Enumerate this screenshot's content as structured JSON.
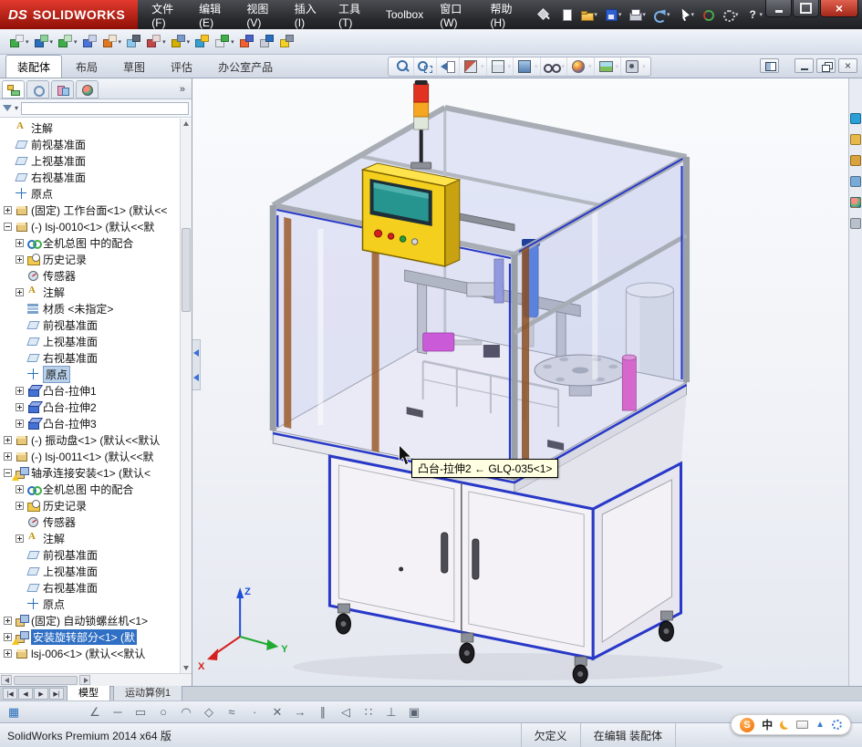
{
  "titlebar": {
    "brand": {
      "prefix": "DS",
      "name": "SOLIDWORKS"
    },
    "menus": [
      "文件(F)",
      "编辑(E)",
      "视图(V)",
      "插入(I)",
      "工具(T)",
      "Toolbox",
      "窗口(W)",
      "帮助(H)"
    ],
    "quick_icons": [
      {
        "name": "new-document"
      },
      {
        "name": "open",
        "dd": true
      },
      {
        "name": "save",
        "dd": true
      },
      {
        "name": "print",
        "dd": true
      },
      {
        "name": "undo",
        "dd": true
      },
      {
        "name": "select",
        "dd": true
      },
      {
        "name": "rebuild"
      },
      {
        "name": "options",
        "dd": true
      },
      {
        "name": "help",
        "dd": true
      }
    ],
    "window_buttons": [
      "minimize",
      "maximize",
      "close"
    ]
  },
  "assembly_toolbar": [
    {
      "name": "insert-components",
      "c1": "#3fae49",
      "c2": "#e8eef4",
      "dd": true
    },
    {
      "name": "mate",
      "c1": "#2a6fbd",
      "c2": "#8fd19e",
      "dd": true
    },
    {
      "name": "linear-component-pattern",
      "c1": "#3fae49",
      "c2": "#bfe6c4",
      "dd": true
    },
    {
      "name": "smart-fasteners",
      "c1": "#4a74d8",
      "c2": "#c9d2e8"
    },
    {
      "name": "move-component",
      "c1": "#e07820",
      "c2": "#f2e3d2",
      "dd": true
    },
    {
      "name": "show-hidden-components",
      "c1": "#8cc8ee",
      "c2": "#5a6472"
    },
    {
      "name": "assembly-features",
      "c1": "#c04848",
      "c2": "#e8d8d8",
      "dd": true
    },
    {
      "name": "reference-geometry",
      "c1": "#d4b000",
      "c2": "#7a98c8",
      "dd": true
    },
    {
      "name": "new-motion-study",
      "c1": "#38a0d0",
      "c2": "#f5c324"
    },
    {
      "name": "bill-of-materials",
      "c1": "#e4e8ee",
      "c2": "#3fae49",
      "dd": true
    },
    {
      "name": "exploded-view",
      "c1": "#f06030",
      "c2": "#4862c8"
    },
    {
      "name": "instant3d",
      "c1": "#c8ccd4",
      "c2": "#2a6fbd"
    },
    {
      "name": "spotlight",
      "c1": "#f5d024",
      "c2": "#8893a4"
    }
  ],
  "command_tabs": [
    {
      "label": "装配体",
      "name": "tab-assembly",
      "active": true
    },
    {
      "label": "布局",
      "name": "tab-layout"
    },
    {
      "label": "草图",
      "name": "tab-sketch"
    },
    {
      "label": "评估",
      "name": "tab-evaluate"
    },
    {
      "label": "办公室产品",
      "name": "tab-office-products"
    }
  ],
  "headsup": [
    {
      "name": "zoom-to-fit"
    },
    {
      "name": "zoom-to-area"
    },
    {
      "name": "previous-view"
    },
    {
      "name": "section-view",
      "dd": true
    },
    {
      "name": "view-orientation",
      "dd": true
    },
    {
      "name": "display-style",
      "dd": true
    },
    {
      "name": "hide-show-items",
      "dd": true
    },
    {
      "name": "edit-appearance",
      "dd": true
    },
    {
      "name": "apply-scene",
      "dd": true
    },
    {
      "name": "view-settings",
      "dd": true
    }
  ],
  "doc_controls": [
    "toggle-display-pane",
    "minimize-document",
    "restore-document",
    "close-document"
  ],
  "taskpane": [
    {
      "name": "solidworks-resources",
      "color": "#2a9fd8"
    },
    {
      "name": "design-library",
      "color": "#e8b84a"
    },
    {
      "name": "file-explorer",
      "color": "#d9a23a"
    },
    {
      "name": "view-palette",
      "color": "#7aaad8"
    },
    {
      "name": "appearances",
      "ball": true
    },
    {
      "name": "custom-properties",
      "color": "#b8c0cc"
    }
  ],
  "panel": {
    "tabs": [
      {
        "name": "featuremanager-tree"
      },
      {
        "name": "property-manager"
      },
      {
        "name": "configuration-manager"
      },
      {
        "name": "display-manager"
      }
    ],
    "overflow": "»"
  },
  "tree": [
    {
      "label": "注解",
      "icon": "annot",
      "indent": 0
    },
    {
      "label": "前视基准面",
      "icon": "plane",
      "indent": 0
    },
    {
      "label": "上视基准面",
      "icon": "plane",
      "indent": 0
    },
    {
      "label": "右视基准面",
      "icon": "plane",
      "indent": 0
    },
    {
      "label": "原点",
      "icon": "origin",
      "indent": 0
    },
    {
      "label": "(固定) 工作台面<1> (默认<<",
      "icon": "part",
      "indent": 0,
      "exp": "plus"
    },
    {
      "label": "(-) lsj-0010<1> (默认<<默",
      "icon": "part",
      "indent": 0,
      "exp": "minus"
    },
    {
      "label": "全机总图 中的配合",
      "icon": "mates",
      "indent": 1,
      "exp": "plus"
    },
    {
      "label": "历史记录",
      "icon": "history",
      "indent": 1,
      "exp": "plus"
    },
    {
      "label": "传感器",
      "icon": "sensor",
      "indent": 1
    },
    {
      "label": "注解",
      "icon": "annot",
      "indent": 1,
      "exp": "plus"
    },
    {
      "label": "材质 <未指定>",
      "icon": "material",
      "indent": 1
    },
    {
      "label": "前视基准面",
      "icon": "plane",
      "indent": 1
    },
    {
      "label": "上视基准面",
      "icon": "plane",
      "indent": 1
    },
    {
      "label": "右视基准面",
      "icon": "plane",
      "indent": 1
    },
    {
      "label": "原点",
      "icon": "origin",
      "indent": 1,
      "boxed": true
    },
    {
      "label": "凸台-拉伸1",
      "icon": "extrude",
      "indent": 1,
      "exp": "plus"
    },
    {
      "label": "凸台-拉伸2",
      "icon": "extrude",
      "indent": 1,
      "exp": "plus"
    },
    {
      "label": "凸台-拉伸3",
      "icon": "extrude",
      "indent": 1,
      "exp": "plus"
    },
    {
      "label": "(-) 振动盘<1> (默认<<默认",
      "icon": "part",
      "indent": 0,
      "exp": "plus"
    },
    {
      "label": "(-) lsj-0011<1> (默认<<默",
      "icon": "part",
      "indent": 0,
      "exp": "plus"
    },
    {
      "label": "轴承连接安装<1> (默认<",
      "icon": "asm",
      "indent": 0,
      "exp": "minus",
      "warn": true
    },
    {
      "label": "全机总图 中的配合",
      "icon": "mates",
      "indent": 1,
      "exp": "plus"
    },
    {
      "label": "历史记录",
      "icon": "history",
      "indent": 1,
      "exp": "plus"
    },
    {
      "label": "传感器",
      "icon": "sensor",
      "indent": 1
    },
    {
      "label": "注解",
      "icon": "annot",
      "indent": 1,
      "exp": "plus"
    },
    {
      "label": "前视基准面",
      "icon": "plane",
      "indent": 1
    },
    {
      "label": "上视基准面",
      "icon": "plane",
      "indent": 1
    },
    {
      "label": "右视基准面",
      "icon": "plane",
      "indent": 1
    },
    {
      "label": "原点",
      "icon": "origin",
      "indent": 1
    },
    {
      "label": "(固定) 自动锁螺丝机<1>",
      "icon": "asm",
      "indent": 0,
      "exp": "plus"
    },
    {
      "label": "安装旋转部分<1> (默",
      "icon": "asm",
      "indent": 0,
      "exp": "plus",
      "warn": true,
      "selected": true
    },
    {
      "label": "lsj-006<1> (默认<<默认",
      "icon": "part",
      "indent": 0,
      "exp": "plus"
    }
  ],
  "viewport": {
    "tooltip": "凸台-拉伸2 ← GLQ-035<1>",
    "triad": {
      "x": "X",
      "y": "Y",
      "z": "Z"
    }
  },
  "bottom_tabs": {
    "nav": [
      "first",
      "prev",
      "next",
      "last"
    ],
    "tabs": [
      {
        "label": "模型",
        "name": "tab-model",
        "active": true
      },
      {
        "label": "运动算例1",
        "name": "tab-motion-study-1"
      }
    ]
  },
  "sketch_toolbar": [
    {
      "name": "grid-settings",
      "glyph": "▦",
      "accent": true
    },
    {
      "name": "smart-dimension",
      "glyph": "∠"
    },
    {
      "name": "line",
      "glyph": "─"
    },
    {
      "name": "rectangle",
      "glyph": "▭"
    },
    {
      "name": "circle",
      "glyph": "○"
    },
    {
      "name": "arc",
      "glyph": "◠"
    },
    {
      "name": "polygon",
      "glyph": "◇"
    },
    {
      "name": "spline",
      "glyph": "≈"
    },
    {
      "name": "point",
      "glyph": "∙"
    },
    {
      "name": "trim-entities",
      "glyph": "✕"
    },
    {
      "name": "convert-entities",
      "glyph": "→"
    },
    {
      "name": "offset-entities",
      "glyph": "∥"
    },
    {
      "name": "mirror-entities",
      "glyph": "◁"
    },
    {
      "name": "linear-sketch-pattern",
      "glyph": "∷"
    },
    {
      "name": "display-relations",
      "glyph": "⊥"
    },
    {
      "name": "quick-snaps",
      "glyph": "▣"
    }
  ],
  "statusbar": {
    "left": "SolidWorks Premium 2014 x64 版",
    "items": [
      "欠定义",
      "在编辑 装配体"
    ]
  },
  "ime": {
    "s": "S",
    "zh": "中"
  }
}
